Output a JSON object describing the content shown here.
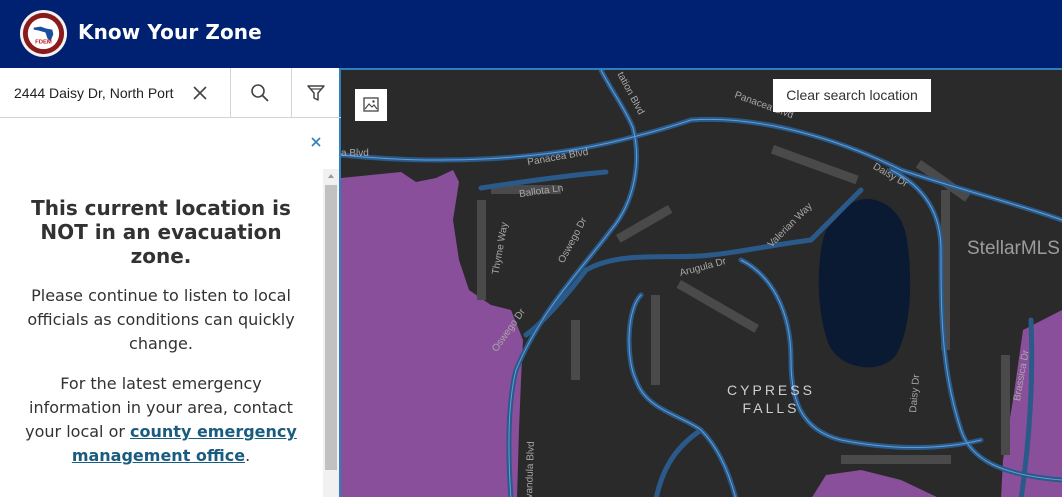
{
  "header": {
    "title": "Know Your Zone",
    "logo_text": "FDEM",
    "color": "#002171"
  },
  "search": {
    "value": "2444 Daisy Dr, North Port",
    "icons": [
      "close-icon",
      "search-icon",
      "filter-icon"
    ]
  },
  "result": {
    "headline": "This current location is NOT in an evacuation zone.",
    "para1": "Please continue to listen to local officials as conditions can quickly change.",
    "para2_before": "For the latest emergency information in your area, contact your local or ",
    "link_text": "county emergency management office",
    "para2_after": "."
  },
  "map": {
    "clear_search_label": "Clear search location",
    "place_name_line1": "CYPRESS",
    "place_name_line2": "FALLS",
    "watermark": "StellarMLS",
    "streets": {
      "panacea_1": "Panacea Blvd",
      "panacea_2": "Panacea Blvd",
      "panacea_3": "a Blvd",
      "station": "tation Blvd",
      "daisy": "Daisy Dr",
      "daisy_2": "Daisy Dr",
      "ballota": "Ballota Ln",
      "valerian": "Valerian Way",
      "thyme": "Thyme Way",
      "oswego": "Oswego Dr",
      "oswego_2": "Oswego Dr",
      "arugula": "Arugula Dr",
      "brassica": "Brassica Dr",
      "lavandula": "Lavandula Blvd"
    },
    "colors": {
      "background": "#2a2a2a",
      "road": "#2a5a8a",
      "zone": "#8a4f9a",
      "lake": "#0a1a33"
    }
  }
}
